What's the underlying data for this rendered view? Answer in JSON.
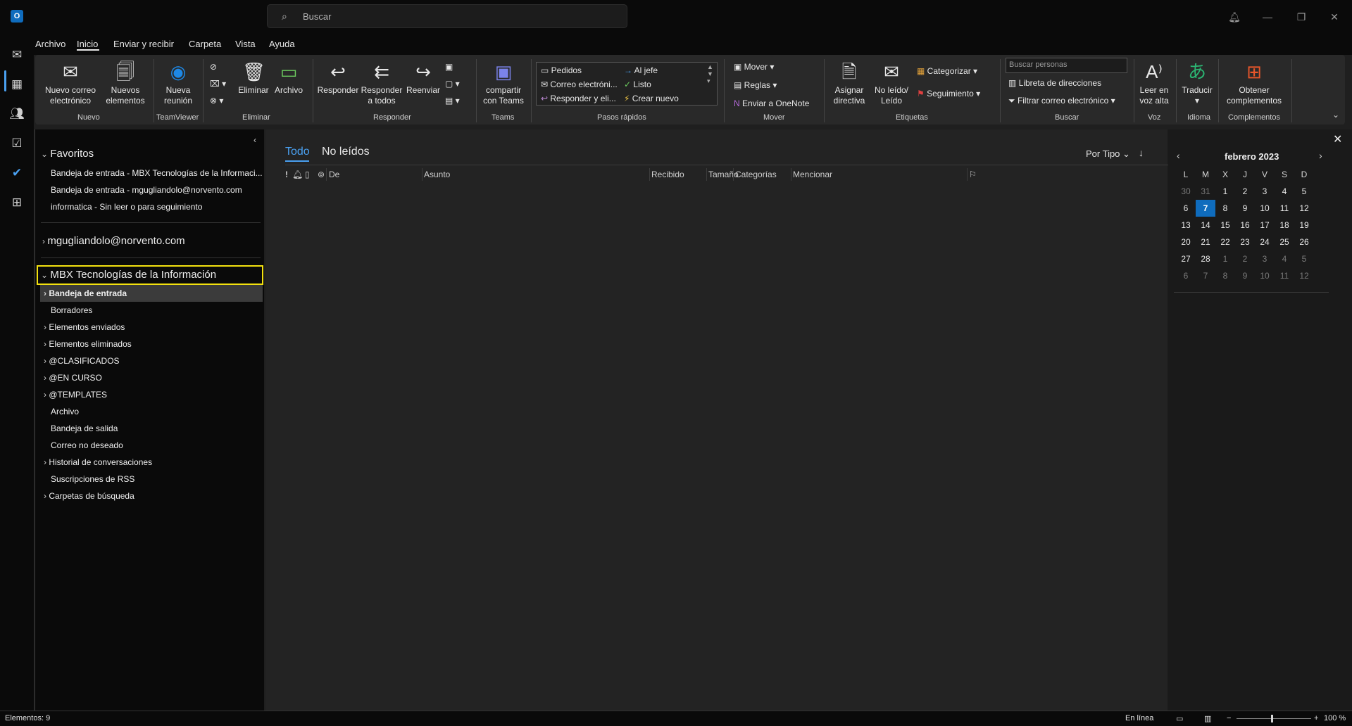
{
  "search": {
    "placeholder": "Buscar"
  },
  "menu": {
    "tabs": [
      "Archivo",
      "Inicio",
      "Enviar y recibir",
      "Carpeta",
      "Vista",
      "Ayuda"
    ],
    "active": "Inicio"
  },
  "ribbon": {
    "nuevo_correo": "Nuevo correo electrónico",
    "nuevos_elementos": "Nuevos elementos",
    "nueva_reunion": "Nueva reunión",
    "eliminar": "Eliminar",
    "archivo": "Archivo",
    "responder": "Responder",
    "responder_todos": "Responder a todos",
    "reenviar": "Reenviar",
    "teams_share": "compartir con Teams",
    "quick_steps": [
      "Pedidos",
      "Correo electróni...",
      "Responder y eli...",
      "Al jefe",
      "Listo",
      "Crear nuevo"
    ],
    "mover": "Mover",
    "reglas": "Reglas",
    "onenote": "Enviar a OneNote",
    "asignar_directiva": "Asignar directiva",
    "no_leido": "No leído/ Leído",
    "categorizar": "Categorizar",
    "seguimiento": "Seguimiento",
    "buscar_personas_placeholder": "Buscar personas",
    "libreta": "Libreta de direcciones",
    "filtrar": "Filtrar correo electrónico",
    "leer_voz": "Leer en voz alta",
    "traducir": "Traducir",
    "complementos": "Obtener complementos",
    "groups": [
      "Nuevo",
      "TeamViewer",
      "Eliminar",
      "Responder",
      "Teams",
      "Pasos rápidos",
      "Mover",
      "Etiquetas",
      "Buscar",
      "Voz",
      "Idioma",
      "Complementos"
    ]
  },
  "folders": {
    "favoritos_label": "Favoritos",
    "favoritos": [
      "Bandeja de entrada - MBX Tecnologías de la Informaci...",
      "Bandeja de entrada - mgugliandolo@norvento.com",
      "informatica - Sin leer o para seguimiento"
    ],
    "account1": "mgugliandolo@norvento.com",
    "account2": "MBX Tecnologías de la Información",
    "items": [
      "Bandeja de entrada",
      "Borradores",
      "Elementos enviados",
      "Elementos eliminados",
      "@CLASIFICADOS",
      "@EN CURSO",
      "@TEMPLATES",
      "Archivo",
      "Bandeja de salida",
      "Correo no deseado",
      "Historial de conversaciones",
      "Suscripciones de RSS",
      "Carpetas de búsqueda"
    ]
  },
  "messages": {
    "tab_all": "Todo",
    "tab_unread": "No leídos",
    "sort": "Por Tipo",
    "columns": [
      "!",
      "De",
      "Asunto",
      "Recibido",
      "Tamaño",
      "Categorías",
      "Mencionar"
    ]
  },
  "calendar": {
    "title": "febrero 2023",
    "weekdays": [
      "L",
      "M",
      "X",
      "J",
      "V",
      "S",
      "D"
    ],
    "weeks": [
      [
        "30",
        "31",
        "1",
        "2",
        "3",
        "4",
        "5"
      ],
      [
        "6",
        "7",
        "8",
        "9",
        "10",
        "11",
        "12"
      ],
      [
        "13",
        "14",
        "15",
        "16",
        "17",
        "18",
        "19"
      ],
      [
        "20",
        "21",
        "22",
        "23",
        "24",
        "25",
        "26"
      ],
      [
        "27",
        "28",
        "1",
        "2",
        "3",
        "4",
        "5"
      ],
      [
        "6",
        "7",
        "8",
        "9",
        "10",
        "11",
        "12"
      ]
    ],
    "today": "7"
  },
  "status": {
    "elementos": "Elementos: 9",
    "online": "En línea",
    "zoom": "100 %"
  },
  "colors": {
    "accent": "#4aa0f0",
    "highlight": "#f3e10f",
    "today": "#0f6cbd"
  }
}
